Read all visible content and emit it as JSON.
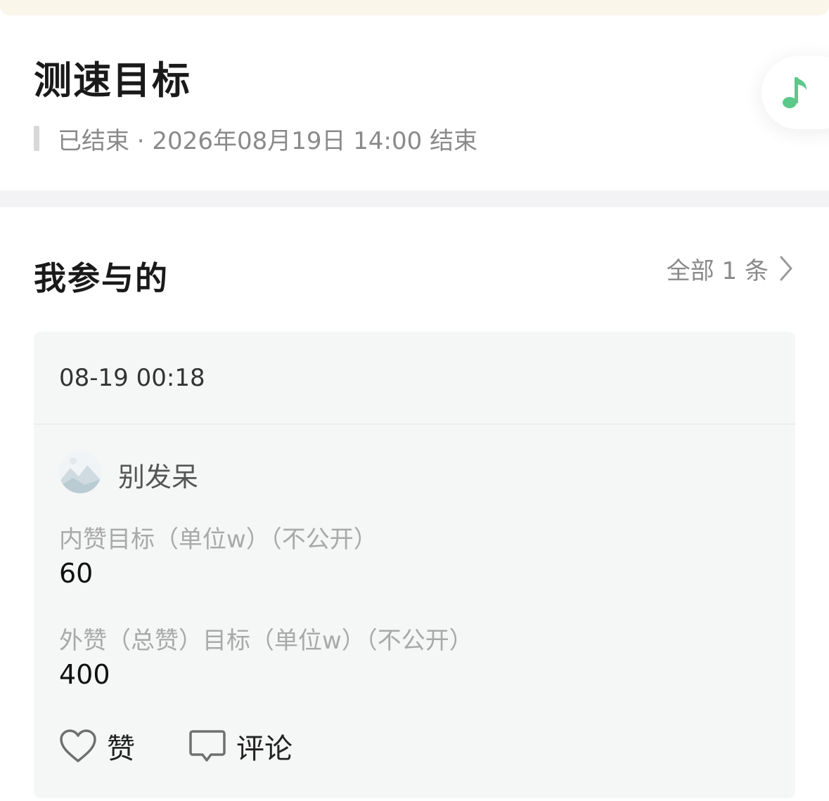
{
  "header": {
    "title": "测速目标",
    "status": "已结束 · 2026年08月19日 14:00 结束",
    "music_icon": "music-note-icon",
    "accent_color": "#5cc88a"
  },
  "section": {
    "title": "我参与的",
    "see_all_label": "全部 1 条"
  },
  "entry": {
    "time": "08-19 00:18",
    "user_name": "别发呆",
    "fields": [
      {
        "label": "内赞目标（单位w）（不公开）",
        "value": "60"
      },
      {
        "label": "外赞（总赞）目标（单位w）（不公开）",
        "value": "400"
      }
    ],
    "actions": {
      "like_label": "赞",
      "comment_label": "评论"
    }
  }
}
